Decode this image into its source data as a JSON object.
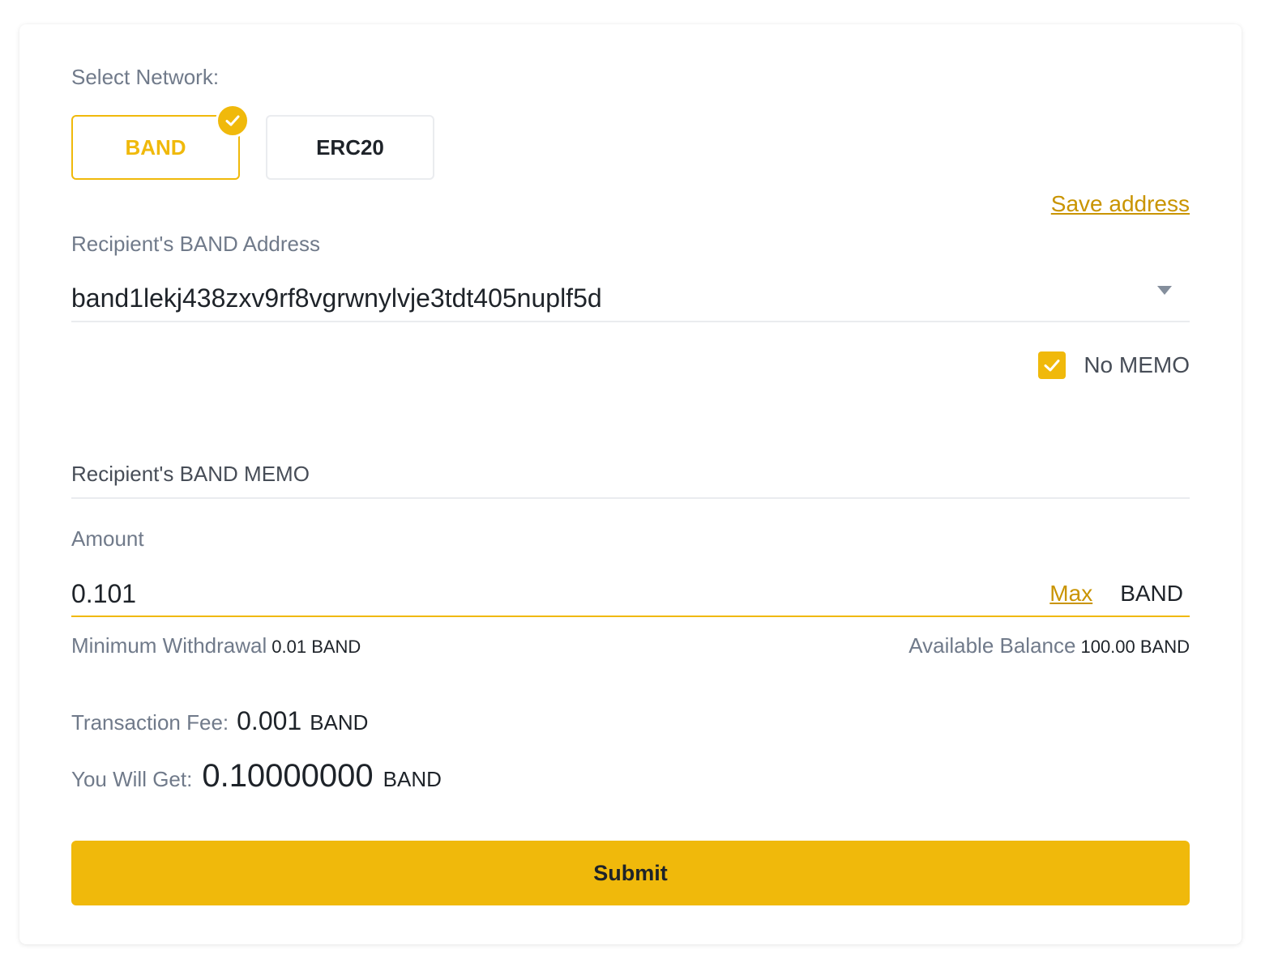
{
  "network": {
    "label": "Select Network:",
    "options": [
      {
        "label": "BAND",
        "selected": true
      },
      {
        "label": "ERC20",
        "selected": false
      }
    ]
  },
  "address": {
    "save_link": "Save address",
    "label": "Recipient's BAND Address",
    "value": "band1lekj438zxv9rf8vgrwnylvje3tdt405nuplf5d"
  },
  "memo": {
    "no_memo_label": "No MEMO",
    "no_memo_checked": true,
    "placeholder": "Recipient's BAND MEMO"
  },
  "amount": {
    "label": "Amount",
    "value": "0.101",
    "max_label": "Max",
    "unit": "BAND",
    "min_label": "Minimum Withdrawal",
    "min_value": "0.01 BAND",
    "balance_label": "Available Balance",
    "balance_value": "100.00 BAND"
  },
  "fee": {
    "label": "Transaction Fee:",
    "value": "0.001",
    "unit": "BAND"
  },
  "receive": {
    "label": "You Will Get:",
    "value": "0.10000000",
    "unit": "BAND"
  },
  "submit_label": "Submit",
  "colors": {
    "accent": "#f0b90b",
    "link": "#c99400",
    "muted": "#707a8a"
  }
}
